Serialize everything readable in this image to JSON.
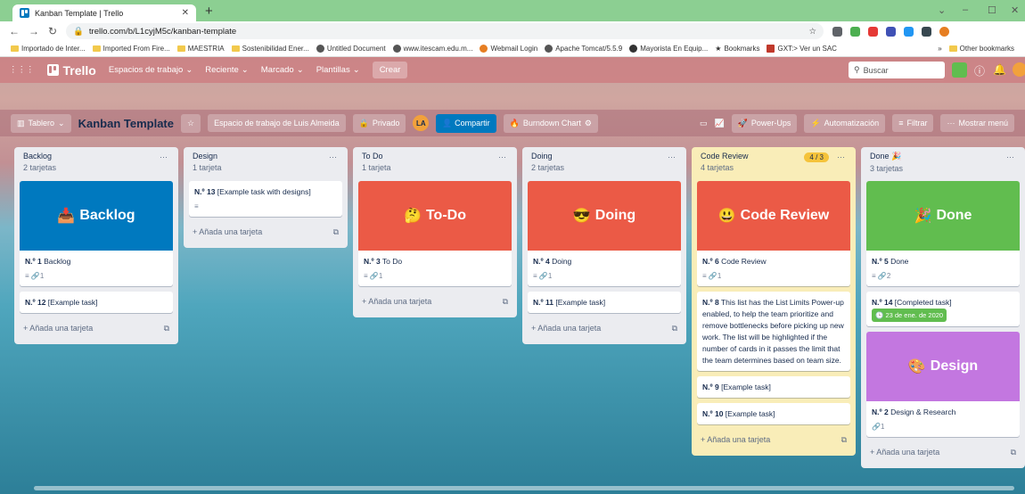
{
  "browser": {
    "tab_title": "Kanban Template | Trello",
    "url": "trello.com/b/L1cyjM5c/kanban-template",
    "bookmarks": [
      "Importado de Inter...",
      "Imported From Fire...",
      "MAESTRIA",
      "Sostenibilidad Ener...",
      "Untitled Document",
      "www.itescam.edu.m...",
      "Webmail Login",
      "Apache Tomcat/5.5.9",
      "Mayorista En Equip...",
      "Bookmarks",
      "GXT:> Ver un SAC",
      "»",
      "Other bookmarks"
    ]
  },
  "header": {
    "brand": "Trello",
    "menus": [
      "Espacios de trabajo",
      "Reciente",
      "Marcado",
      "Plantillas"
    ],
    "create": "Crear",
    "search_placeholder": "Buscar"
  },
  "board": {
    "view": "Tablero",
    "title": "Kanban Template",
    "workspace": "Espacio de trabajo de Luis Almeida",
    "visibility": "Privado",
    "avatar": "LA",
    "share": "Compartir",
    "burndown": "Burndown Chart",
    "powerups": "Power-Ups",
    "automation": "Automatización",
    "filter": "Filtrar",
    "menu": "Mostrar menú"
  },
  "lists": [
    {
      "name": "Backlog",
      "count": "2 tarjetas",
      "add": "+ Añada una tarjeta",
      "cards": [
        {
          "cover": "Backlog",
          "cover_color": "#0079bf",
          "num": "N.º 1",
          "text": "Backlog",
          "badges": "≡  🔗1"
        },
        {
          "num": "N.º 12",
          "text": "[Example task]"
        }
      ]
    },
    {
      "name": "Design",
      "count": "1 tarjeta",
      "add": "+ Añada una tarjeta",
      "cards": [
        {
          "num": "N.º 13",
          "text": "[Example task with designs]",
          "badges": "≡"
        }
      ]
    },
    {
      "name": "To Do",
      "count": "1 tarjeta",
      "add": "+ Añada una tarjeta",
      "cards": [
        {
          "cover": "To-Do",
          "cover_color": "#eb5a46",
          "num": "N.º 3",
          "text": "To Do",
          "badges": "≡  🔗1"
        }
      ]
    },
    {
      "name": "Doing",
      "count": "2 tarjetas",
      "add": "+ Añada una tarjeta",
      "cards": [
        {
          "cover": "Doing",
          "cover_color": "#eb5a46",
          "num": "N.º 4",
          "text": "Doing",
          "badges": "≡  🔗1"
        },
        {
          "num": "N.º 11",
          "text": "[Example task]"
        }
      ]
    },
    {
      "name": "Code Review",
      "count": "4 tarjetas",
      "limit": "4 / 3",
      "add": "+ Añada una tarjeta",
      "cards": [
        {
          "cover": "Code Review",
          "cover_color": "#eb5a46",
          "num": "N.º 6",
          "text": "Code Review",
          "badges": "≡  🔗1"
        },
        {
          "num": "N.º 8",
          "text": "This list has the List Limits Power-up enabled, to help the team prioritize and remove bottlenecks before picking up new work. The list will be highlighted if the number of cards in it passes the limit that the team determines based on team size."
        },
        {
          "num": "N.º 9",
          "text": "[Example task]"
        },
        {
          "num": "N.º 10",
          "text": "[Example task]"
        }
      ]
    },
    {
      "name": "Done",
      "count": "3 tarjetas",
      "add": "+ Añada una tarjeta",
      "cards": [
        {
          "cover": "Done",
          "cover_color": "#61bd4f",
          "num": "N.º 5",
          "text": "Done",
          "badges": "≡  🔗2"
        },
        {
          "num": "N.º 14",
          "text": "[Completed task]",
          "date": "23 de ene. de 2020"
        },
        {
          "cover": "Design",
          "cover_color": "#c377e0",
          "num": "N.º 2",
          "text": "Design & Research",
          "badges": "🔗1"
        }
      ]
    }
  ]
}
